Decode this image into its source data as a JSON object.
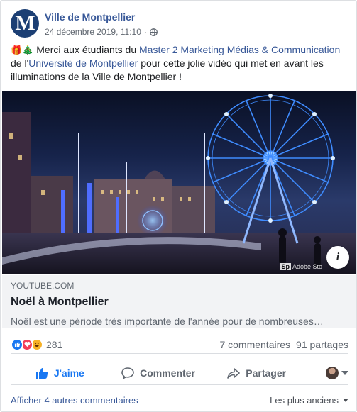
{
  "post": {
    "page_name": "Ville de Montpellier",
    "avatar_letter": "M",
    "date": "24 décembre 2019, 11:10",
    "separator": "·",
    "text": {
      "emojis": "🎁🎄",
      "part1": " Merci aux étudiants du ",
      "link1": "Master 2 Marketing Médias & Communication",
      "part2": " de l'",
      "link2": "Université de Montpellier",
      "part3": " pour cette jolie vidéo qui met en avant les illuminations de la Ville de Montpellier !"
    }
  },
  "media": {
    "watermark_sp": "Sp",
    "watermark_text": "Adobe Sto",
    "info_label": "i"
  },
  "link_preview": {
    "domain": "YOUTUBE.COM",
    "title": "Noël à Montpellier",
    "description": "Noël est une période très importante de l'année pour de nombreuses…"
  },
  "stats": {
    "reaction_count": "281",
    "comments": "7 commentaires",
    "shares": "91 partages"
  },
  "actions": {
    "like": "J'aime",
    "comment": "Commenter",
    "share": "Partager"
  },
  "footer": {
    "more_comments": "Afficher 4 autres commentaires",
    "sort": "Les plus anciens"
  },
  "colors": {
    "link": "#385898",
    "like_blue": "#1877f2",
    "love_red": "#f33e58",
    "haha_yellow": "#f7b125",
    "avatar_navy": "#1c3f74"
  }
}
